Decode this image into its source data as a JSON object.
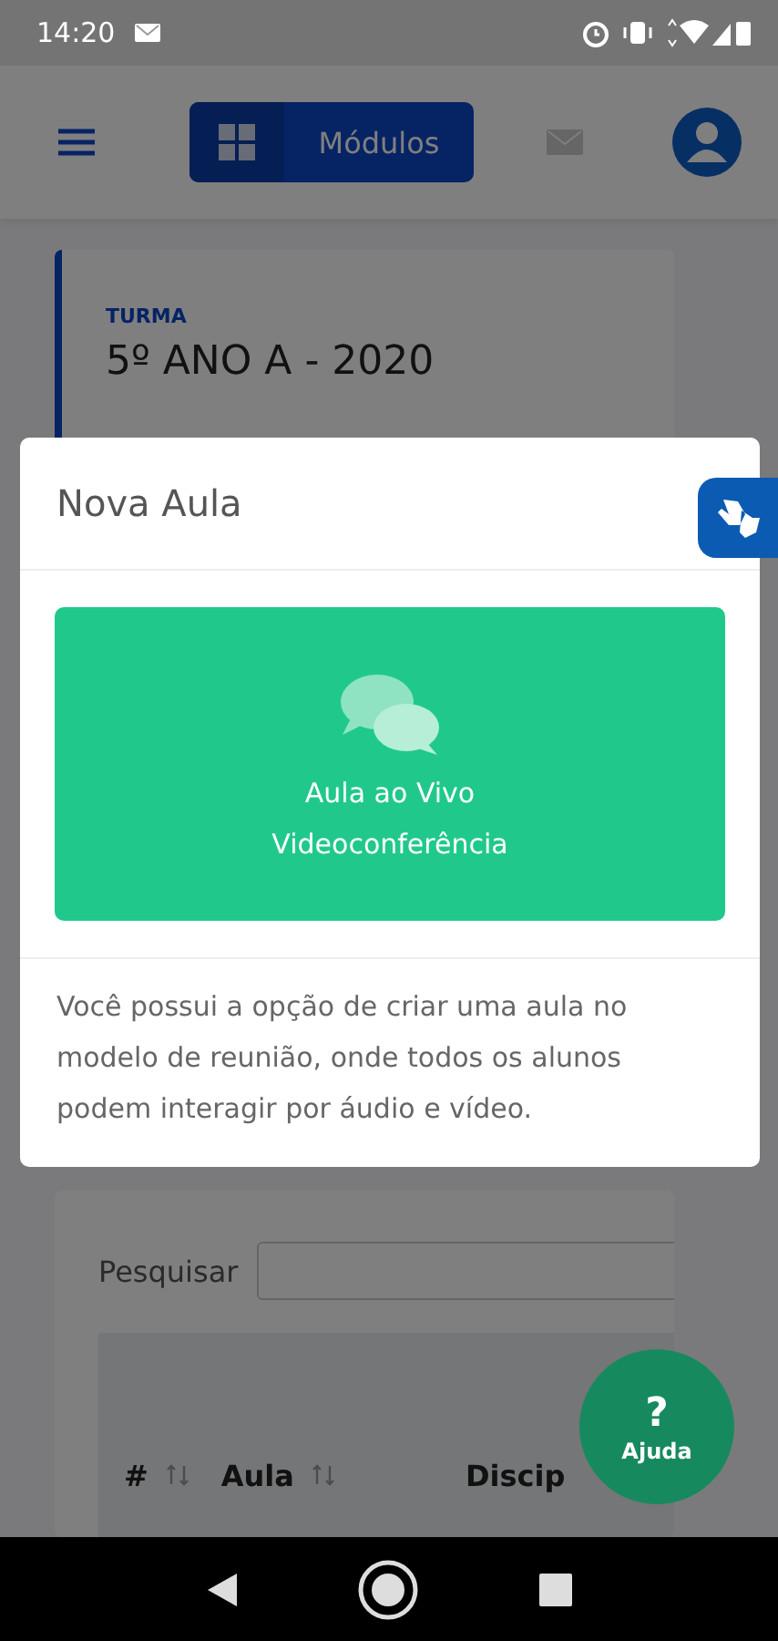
{
  "status_bar": {
    "time": "14:20"
  },
  "header": {
    "modules_button": {
      "label": "Módulos"
    }
  },
  "class_card": {
    "label": "TURMA",
    "title": "5º ANO A - 2020"
  },
  "search": {
    "label": "Pesquisar"
  },
  "table": {
    "columns": [
      {
        "label": "#",
        "sortable": true
      },
      {
        "label": "Aula",
        "sortable": true
      },
      {
        "label": "Discip",
        "sortable": false
      }
    ]
  },
  "dialog": {
    "title": "Nova Aula",
    "option": {
      "title": "Aula ao Vivo",
      "subtitle": "Videoconferência"
    },
    "description": "Você possui a opção de criar uma aula no modelo de reunião, onde todos os alunos podem interagir por áudio e vídeo."
  },
  "help_button": {
    "symbol": "?",
    "label": "Ajuda"
  }
}
